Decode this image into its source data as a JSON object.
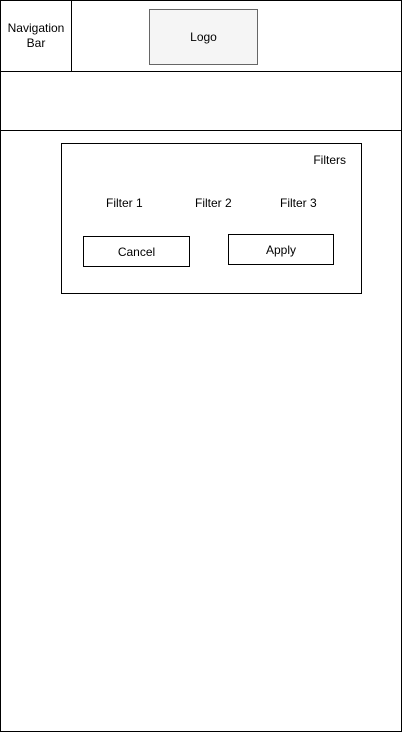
{
  "header": {
    "nav_label": "Navigation Bar",
    "logo_label": "Logo"
  },
  "filters": {
    "title": "Filters",
    "options": [
      "Filter 1",
      "Filter 2",
      "Filter 3"
    ],
    "cancel_label": "Cancel",
    "apply_label": "Apply"
  }
}
